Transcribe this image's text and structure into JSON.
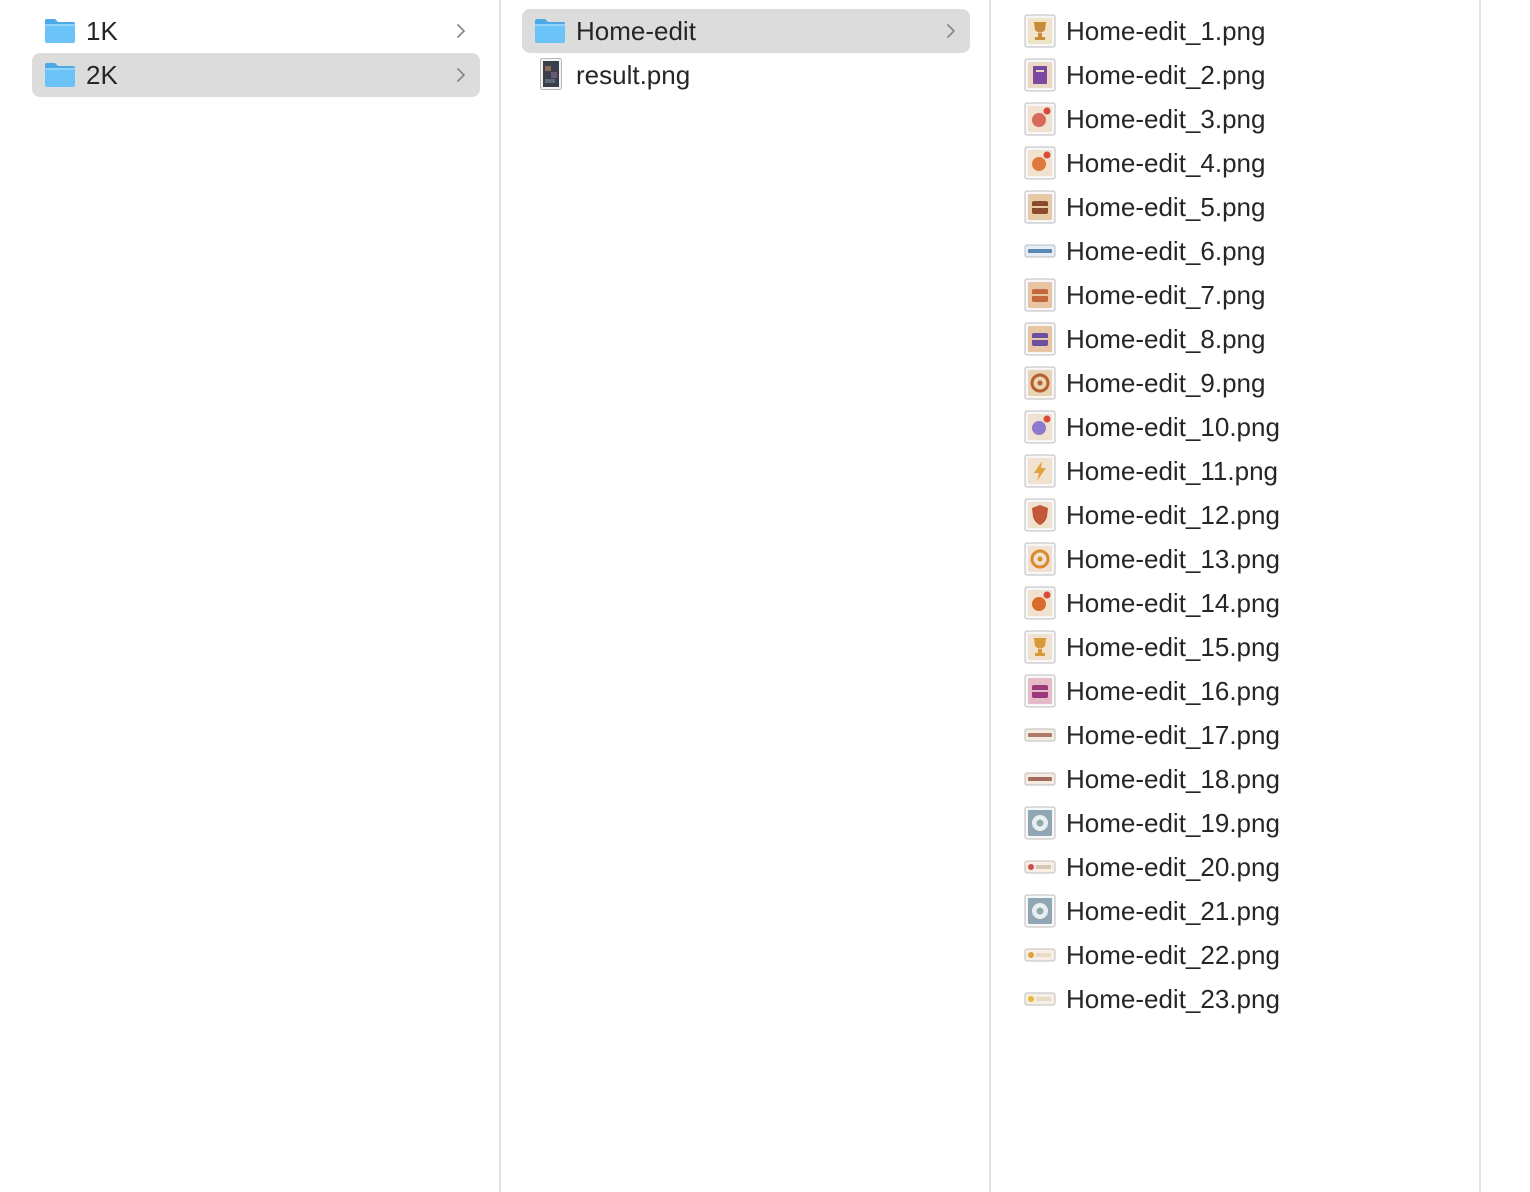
{
  "columns": [
    {
      "items": [
        {
          "label": "1K",
          "kind": "folder",
          "selected": false,
          "has_children": true
        },
        {
          "label": "2K",
          "kind": "folder",
          "selected": true,
          "has_children": true
        }
      ]
    },
    {
      "items": [
        {
          "label": "Home-edit",
          "kind": "folder",
          "selected": true,
          "has_children": true
        },
        {
          "label": "result.png",
          "kind": "image-portrait",
          "selected": false,
          "has_children": false
        }
      ]
    },
    {
      "items": [
        {
          "label": "Home-edit_1.png",
          "kind": "image",
          "thumb": {
            "bg": "#efe3c8",
            "fg": "#c98a3a",
            "shape": "trophy"
          }
        },
        {
          "label": "Home-edit_2.png",
          "kind": "image",
          "thumb": {
            "bg": "#e9d8c3",
            "fg": "#7b4aa0",
            "shape": "book"
          }
        },
        {
          "label": "Home-edit_3.png",
          "kind": "image",
          "thumb": {
            "bg": "#f1e2cf",
            "fg": "#d86a5a",
            "shape": "badge"
          }
        },
        {
          "label": "Home-edit_4.png",
          "kind": "image",
          "thumb": {
            "bg": "#f1e2cf",
            "fg": "#e07a3c",
            "shape": "badge"
          }
        },
        {
          "label": "Home-edit_5.png",
          "kind": "image",
          "thumb": {
            "bg": "#e7c9a8",
            "fg": "#8a4b2a",
            "shape": "castle"
          }
        },
        {
          "label": "Home-edit_6.png",
          "kind": "image",
          "thumb": {
            "bg": "#e6eef5",
            "fg": "#5a88b5",
            "shape": "bar"
          }
        },
        {
          "label": "Home-edit_7.png",
          "kind": "image",
          "thumb": {
            "bg": "#e9c6a3",
            "fg": "#c5683d",
            "shape": "case"
          }
        },
        {
          "label": "Home-edit_8.png",
          "kind": "image",
          "thumb": {
            "bg": "#e9c6a3",
            "fg": "#6b4fa0",
            "shape": "case"
          }
        },
        {
          "label": "Home-edit_9.png",
          "kind": "image",
          "thumb": {
            "bg": "#ead2b4",
            "fg": "#b5602d",
            "shape": "wheel"
          }
        },
        {
          "label": "Home-edit_10.png",
          "kind": "image",
          "thumb": {
            "bg": "#f1e2cf",
            "fg": "#8c7ad0",
            "shape": "badge"
          }
        },
        {
          "label": "Home-edit_11.png",
          "kind": "image",
          "thumb": {
            "bg": "#f1e2cf",
            "fg": "#e2a23a",
            "shape": "bolt"
          }
        },
        {
          "label": "Home-edit_12.png",
          "kind": "image",
          "thumb": {
            "bg": "#f1e2cf",
            "fg": "#c25a3a",
            "shape": "shield"
          }
        },
        {
          "label": "Home-edit_13.png",
          "kind": "image",
          "thumb": {
            "bg": "#f1e2cf",
            "fg": "#d98a2c",
            "shape": "ring"
          }
        },
        {
          "label": "Home-edit_14.png",
          "kind": "image",
          "thumb": {
            "bg": "#f1e2cf",
            "fg": "#d96a2c",
            "shape": "badge"
          }
        },
        {
          "label": "Home-edit_15.png",
          "kind": "image",
          "thumb": {
            "bg": "#f1e2cf",
            "fg": "#d99a3c",
            "shape": "trophy"
          }
        },
        {
          "label": "Home-edit_16.png",
          "kind": "image",
          "thumb": {
            "bg": "#e7b9c9",
            "fg": "#9a3a7a",
            "shape": "chest"
          }
        },
        {
          "label": "Home-edit_17.png",
          "kind": "image",
          "thumb": {
            "bg": "#f4ece4",
            "fg": "#b07a6a",
            "shape": "bar"
          }
        },
        {
          "label": "Home-edit_18.png",
          "kind": "image",
          "thumb": {
            "bg": "#f4ece4",
            "fg": "#a46a5a",
            "shape": "bar"
          }
        },
        {
          "label": "Home-edit_19.png",
          "kind": "image",
          "thumb": {
            "bg": "#8fa7b3",
            "fg": "#e9eef1",
            "shape": "gear"
          }
        },
        {
          "label": "Home-edit_20.png",
          "kind": "image",
          "thumb": {
            "bg": "#f6efe6",
            "fg": "#d44a4a",
            "shape": "heart-bar"
          }
        },
        {
          "label": "Home-edit_21.png",
          "kind": "image",
          "thumb": {
            "bg": "#8fa7b3",
            "fg": "#e9eef1",
            "shape": "gear"
          }
        },
        {
          "label": "Home-edit_22.png",
          "kind": "image",
          "thumb": {
            "bg": "#f6efe6",
            "fg": "#e2a23a",
            "shape": "coin-bar"
          }
        },
        {
          "label": "Home-edit_23.png",
          "kind": "image",
          "thumb": {
            "bg": "#f6efe6",
            "fg": "#e6b83a",
            "shape": "coin-bar"
          }
        }
      ]
    }
  ],
  "colors": {
    "selection": "#dcdcdc",
    "folder_body": "#6cc3f7",
    "folder_tab": "#4aa9e6",
    "text": "#262626",
    "separator": "#e3e3e3",
    "chevron": "#8a8a8a"
  }
}
